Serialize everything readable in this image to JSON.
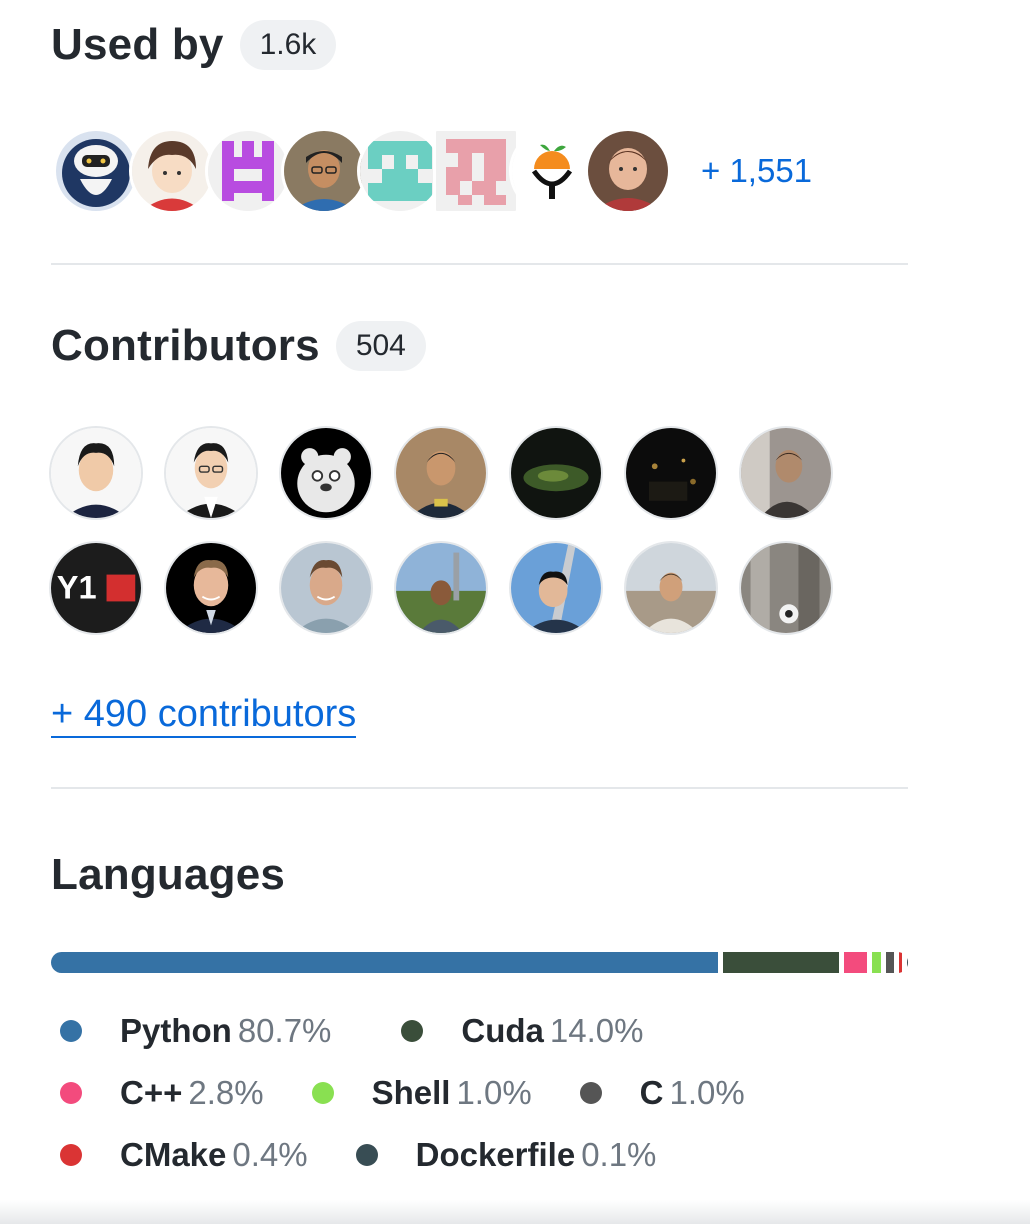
{
  "used_by": {
    "title": "Used by",
    "count": "1.6k",
    "more_label": "+ 1,551",
    "avatars": [
      "robot-avatar",
      "anime-avatar",
      "identicon-purple",
      "person-avatar",
      "identicon-teal",
      "identicon-pink",
      "orange-logo-avatar",
      "person-avatar"
    ]
  },
  "contributors": {
    "title": "Contributors",
    "count": "504",
    "more_label": "+ 490 contributors"
  },
  "languages": {
    "title": "Languages",
    "items": [
      {
        "name": "Python",
        "percent": "80.7%",
        "value": 80.7,
        "color": "#3572A5"
      },
      {
        "name": "Cuda",
        "percent": "14.0%",
        "value": 14.0,
        "color": "#3A4E3A"
      },
      {
        "name": "C++",
        "percent": "2.8%",
        "value": 2.8,
        "color": "#f34b7d"
      },
      {
        "name": "Shell",
        "percent": "1.0%",
        "value": 1.0,
        "color": "#89e051"
      },
      {
        "name": "C",
        "percent": "1.0%",
        "value": 1.0,
        "color": "#555555"
      },
      {
        "name": "CMake",
        "percent": "0.4%",
        "value": 0.4,
        "color": "#DA3434"
      },
      {
        "name": "Dockerfile",
        "percent": "0.1%",
        "value": 0.1,
        "color": "#384d54"
      }
    ]
  }
}
